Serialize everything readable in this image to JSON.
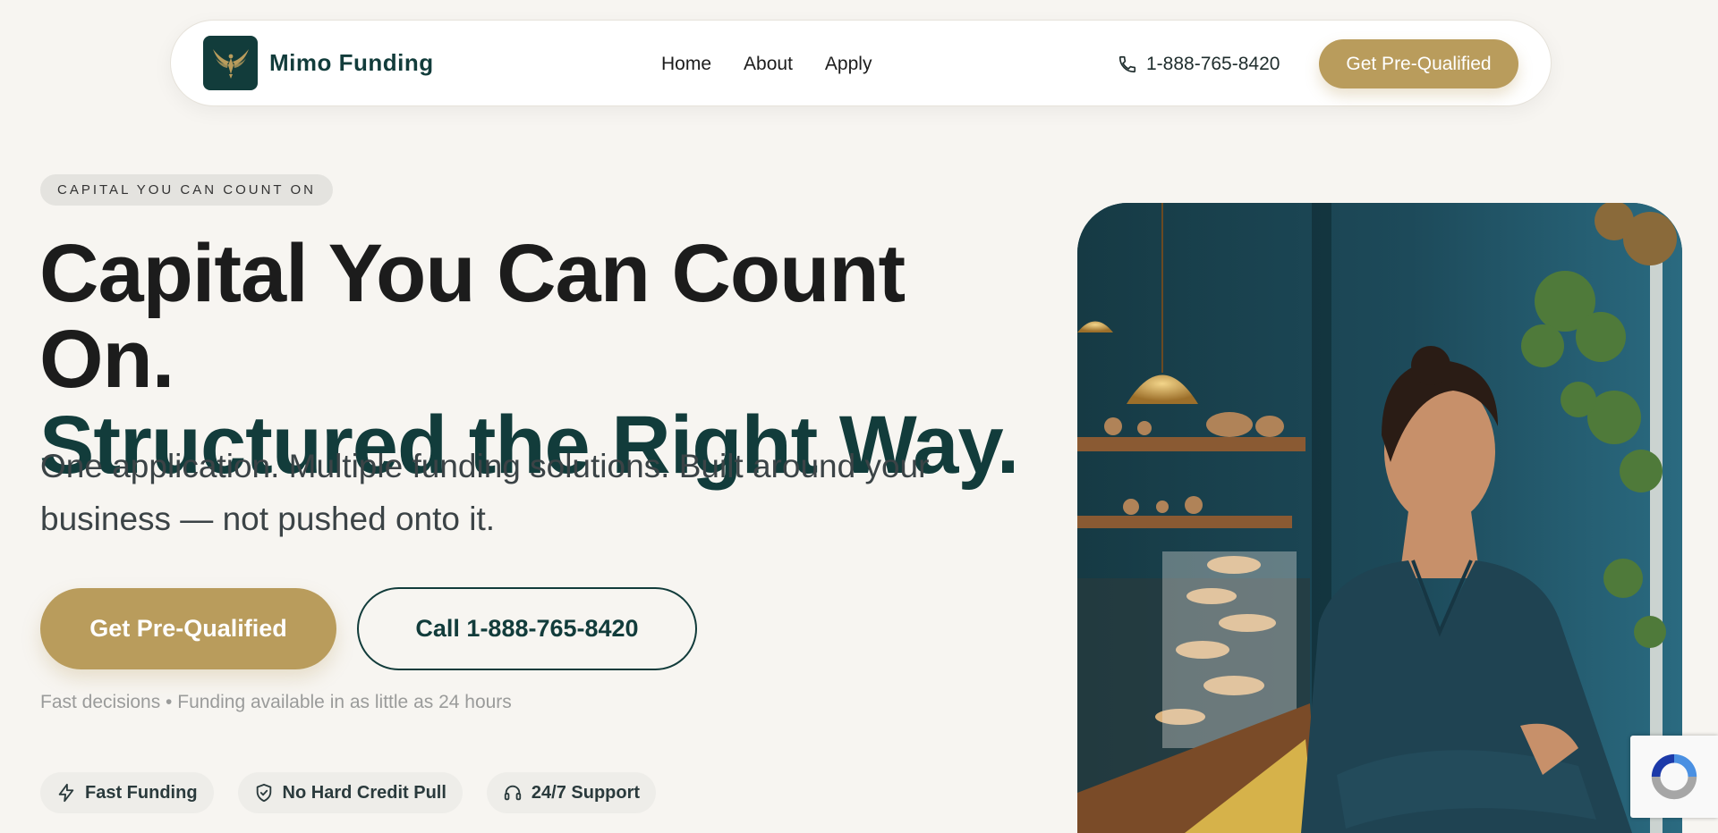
{
  "nav": {
    "brand": "Mimo Funding",
    "links": [
      {
        "label": "Home"
      },
      {
        "label": "About"
      },
      {
        "label": "Apply"
      }
    ],
    "phone": "1-888-765-8420",
    "cta_label": "Get Pre-Qualified"
  },
  "hero": {
    "eyebrow": "CAPITAL YOU CAN COUNT ON",
    "headline_line1": "Capital You Can Count On.",
    "headline_line2": "Structured the Right Way.",
    "lead": "One application. Multiple funding solutions. Built around your business — not pushed onto it.",
    "primary_cta": "Get Pre-Qualified",
    "secondary_cta": "Call 1-888-765-8420",
    "fineprint": "Fast decisions • Funding available in as little as 24 hours",
    "badges": [
      {
        "label": "Fast Funding",
        "icon": "bolt-icon"
      },
      {
        "label": "No Hard Credit Pull",
        "icon": "shield-check-icon"
      },
      {
        "label": "24/7 Support",
        "icon": "headset-icon"
      }
    ]
  },
  "colors": {
    "background": "#f7f5f1",
    "brand_dark": "#123c3b",
    "accent_gold": "#b99c5c"
  }
}
